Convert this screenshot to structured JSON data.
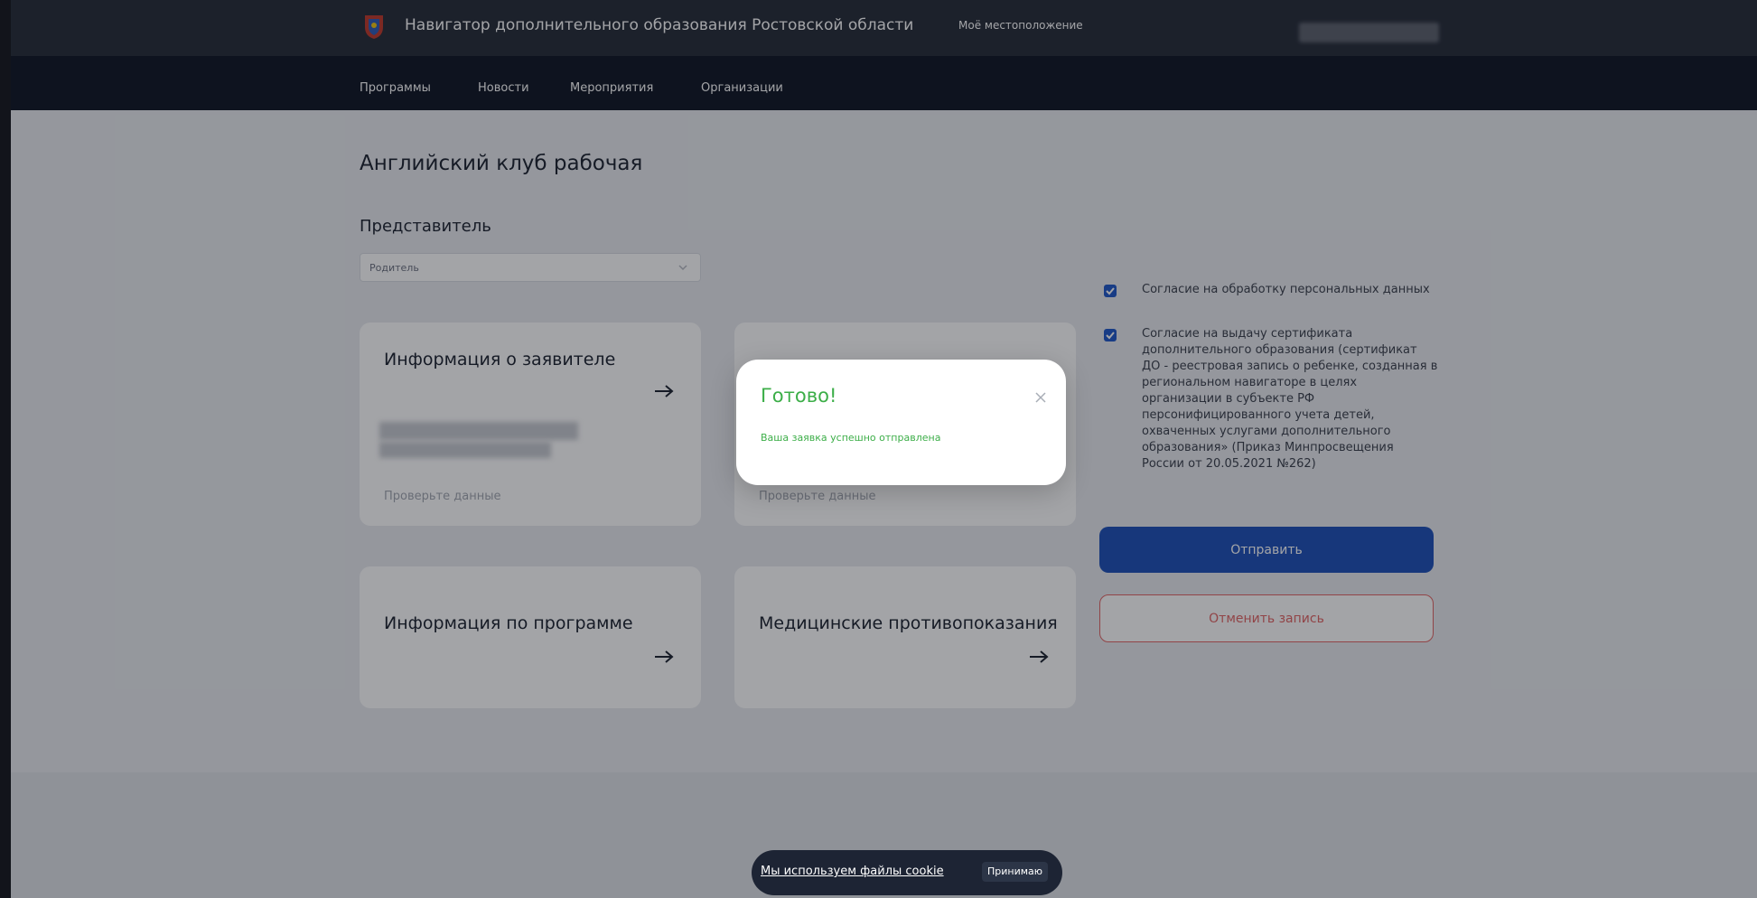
{
  "header": {
    "site_title": "Навигатор дополнительного образования Ростовской области",
    "location_label": "Моё местоположение"
  },
  "nav": {
    "items": [
      {
        "label": "Программы"
      },
      {
        "label": "Новости"
      },
      {
        "label": "Мероприятия"
      },
      {
        "label": "Организации"
      }
    ]
  },
  "main": {
    "heading": "Английский клуб рабочая",
    "representative": {
      "label": "Представитель",
      "value": "Родитель"
    },
    "cards": [
      {
        "title": "Информация о заявителе",
        "hint": "Проверьте данные"
      },
      {
        "title": "",
        "hint": "Проверьте данные"
      },
      {
        "title": "Информация по программе"
      },
      {
        "title": "Медицинские противопоказания"
      }
    ]
  },
  "consents": [
    {
      "checked": true,
      "text": "Согласие на обработку персональных данных"
    },
    {
      "checked": true,
      "text": "Согласие на выдачу сертификата дополнительного образования (сертификат ДО - реестровая запись о ребенке, созданная в региональном навигаторе в целях организации в субъекте РФ персонифицированного учета детей, охваченных услугами дополнительного образования» (Приказ Минпросвещения России от 20.05.2021 №262)"
    }
  ],
  "actions": {
    "submit_label": "Отправить",
    "cancel_label": "Отменить запись"
  },
  "modal": {
    "title": "Готово!",
    "message": "Ваша заявка успешно отправлена"
  },
  "cookie": {
    "text": "Мы используем файлы cookie",
    "accept_label": "Принимаю"
  },
  "colors": {
    "header": "#262c38",
    "nav": "#0f1624",
    "primary": "#1d50b8",
    "danger": "#e26565",
    "success": "#3cae48"
  }
}
